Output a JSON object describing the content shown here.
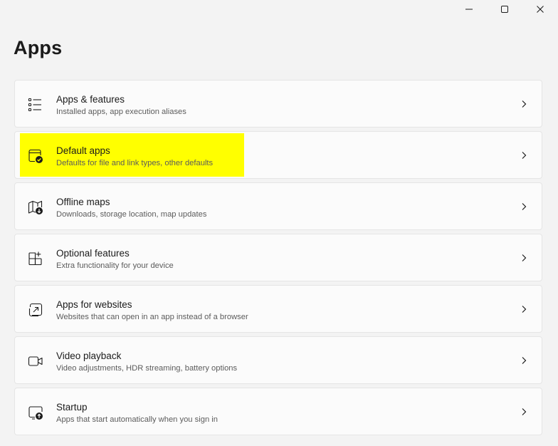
{
  "window": {
    "controls": {
      "minimize_icon": "minimize-icon",
      "maximize_icon": "maximize-icon",
      "close_icon": "close-icon"
    }
  },
  "page": {
    "title": "Apps"
  },
  "items": [
    {
      "title": "Apps & features",
      "description": "Installed apps, app execution aliases",
      "icon": "apps-features-icon"
    },
    {
      "title": "Default apps",
      "description": "Defaults for file and link types, other defaults",
      "icon": "default-apps-icon",
      "highlighted": true,
      "highlight_color": "#ffff00"
    },
    {
      "title": "Offline maps",
      "description": "Downloads, storage location, map updates",
      "icon": "offline-maps-icon"
    },
    {
      "title": "Optional features",
      "description": "Extra functionality for your device",
      "icon": "optional-features-icon"
    },
    {
      "title": "Apps for websites",
      "description": "Websites that can open in an app instead of a browser",
      "icon": "apps-for-websites-icon"
    },
    {
      "title": "Video playback",
      "description": "Video adjustments, HDR streaming, battery options",
      "icon": "video-playback-icon"
    },
    {
      "title": "Startup",
      "description": "Apps that start automatically when you sign in",
      "icon": "startup-icon"
    }
  ]
}
